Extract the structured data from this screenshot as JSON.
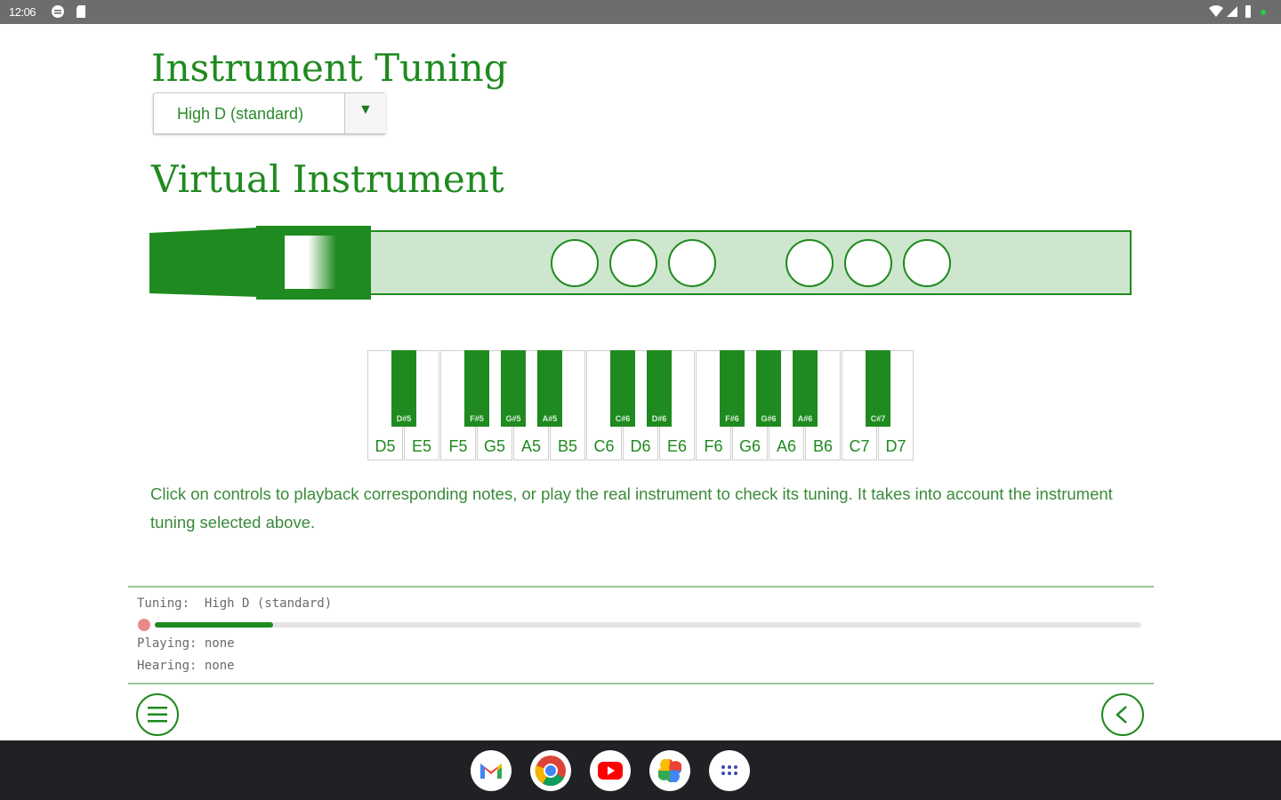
{
  "statusbar": {
    "time": "12:06"
  },
  "page": {
    "tuning_heading": "Instrument Tuning",
    "tuning_select": {
      "value": "High D (standard)",
      "arrow": "▼"
    },
    "virtual_heading": "Virtual Instrument",
    "keyboard": {
      "white_keys": [
        "D5",
        "E5",
        "F5",
        "G5",
        "A5",
        "B5",
        "C6",
        "D6",
        "E6",
        "F6",
        "G6",
        "A6",
        "B6",
        "C7",
        "D7"
      ],
      "black_keys": [
        "D#5",
        "F#5",
        "G#5",
        "A#5",
        "C#6",
        "D#6",
        "F#6",
        "G#6",
        "A#6",
        "C#7"
      ]
    },
    "description": "Click on controls to playback corresponding notes, or play the real instrument to check its tuning. It takes into account the instrument tuning selected above."
  },
  "status_panel": {
    "tuning_label": "Tuning:",
    "tuning_value": "High D (standard)",
    "playing_label": "Playing:",
    "playing_value": "none",
    "hearing_label": "Hearing:",
    "hearing_value": "none",
    "progress_fraction": 0.12
  },
  "colors": {
    "accent": "#1f8a1f",
    "light_green": "#cde6cd",
    "record_dot": "#e88a8a"
  },
  "taskbar": {
    "apps": [
      "gmail-icon",
      "chrome-icon",
      "youtube-icon",
      "photos-icon",
      "app-launcher-icon"
    ]
  }
}
